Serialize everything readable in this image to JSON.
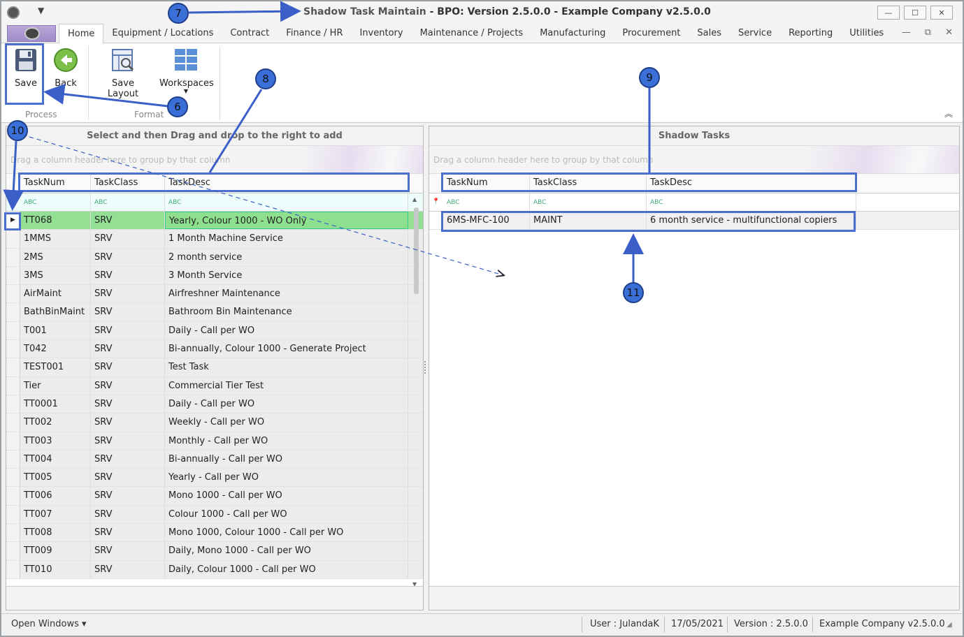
{
  "window": {
    "title_prefix": "Shadow Task Maintain",
    "title_suffix": " - BPO: Version 2.5.0.0 - Example Company v2.5.0.0",
    "minimize": "—",
    "maximize": "☐",
    "close": "✕"
  },
  "menu": {
    "tabs": [
      "Home",
      "Equipment / Locations",
      "Contract",
      "Finance / HR",
      "Inventory",
      "Maintenance / Projects",
      "Manufacturing",
      "Procurement",
      "Sales",
      "Service",
      "Reporting",
      "Utilities"
    ],
    "mdi_min": "—",
    "mdi_restore": "⧉",
    "mdi_close": "✕"
  },
  "ribbon": {
    "save": "Save",
    "back": "Back",
    "save_layout": "Save Layout",
    "workspaces": "Workspaces",
    "group_process": "Process",
    "group_format": "Format"
  },
  "left_panel": {
    "title": "Select and then Drag and drop to the right to add",
    "group_hint": "Drag a column header here to group by that column",
    "columns": [
      "TaskNum",
      "TaskClass",
      "TaskDesc"
    ],
    "filter_glyph": "ABC",
    "rows": [
      [
        "TT068",
        "SRV",
        "Yearly, Colour 1000 - WO Only"
      ],
      [
        "1MMS",
        "SRV",
        "1 Month Machine Service"
      ],
      [
        "2MS",
        "SRV",
        "2 month service"
      ],
      [
        "3MS",
        "SRV",
        "3 Month Service"
      ],
      [
        "AirMaint",
        "SRV",
        "Airfreshner Maintenance"
      ],
      [
        "BathBinMaint",
        "SRV",
        "Bathroom Bin Maintenance"
      ],
      [
        "T001",
        "SRV",
        "Daily - Call per WO"
      ],
      [
        "T042",
        "SRV",
        "Bi-annually, Colour 1000 - Generate Project"
      ],
      [
        "TEST001",
        "SRV",
        "Test Task"
      ],
      [
        "Tier",
        "SRV",
        "Commercial Tier Test"
      ],
      [
        "TT0001",
        "SRV",
        "Daily - Call per WO"
      ],
      [
        "TT002",
        "SRV",
        "Weekly - Call per WO"
      ],
      [
        "TT003",
        "SRV",
        " Monthly - Call per WO"
      ],
      [
        "TT004",
        "SRV",
        "Bi-annually - Call per WO"
      ],
      [
        "TT005",
        "SRV",
        "Yearly - Call per WO"
      ],
      [
        "TT006",
        "SRV",
        "Mono 1000 - Call per WO"
      ],
      [
        "TT007",
        "SRV",
        "Colour 1000 - Call per WO"
      ],
      [
        "TT008",
        "SRV",
        "Mono 1000, Colour 1000 - Call per WO"
      ],
      [
        "TT009",
        "SRV",
        "Daily, Mono 1000 - Call per WO"
      ],
      [
        "TT010",
        "SRV",
        "Daily, Colour 1000 - Call per WO"
      ]
    ]
  },
  "right_panel": {
    "title": "Shadow Tasks",
    "group_hint": "Drag a column header here to group by that column",
    "columns": [
      "TaskNum",
      "TaskClass",
      "TaskDesc"
    ],
    "filter_glyph": "ABC",
    "rows": [
      [
        "6MS-MFC-100",
        "MAINT",
        "6 month service - multifunctional copiers"
      ]
    ]
  },
  "status": {
    "open_windows": "Open Windows ▾",
    "user": "User : JulandaK",
    "date": "17/05/2021",
    "version": "Version : 2.5.0.0",
    "company": "Example Company v2.5.0.0"
  },
  "callouts": [
    "6",
    "7",
    "8",
    "9",
    "10",
    "11"
  ]
}
